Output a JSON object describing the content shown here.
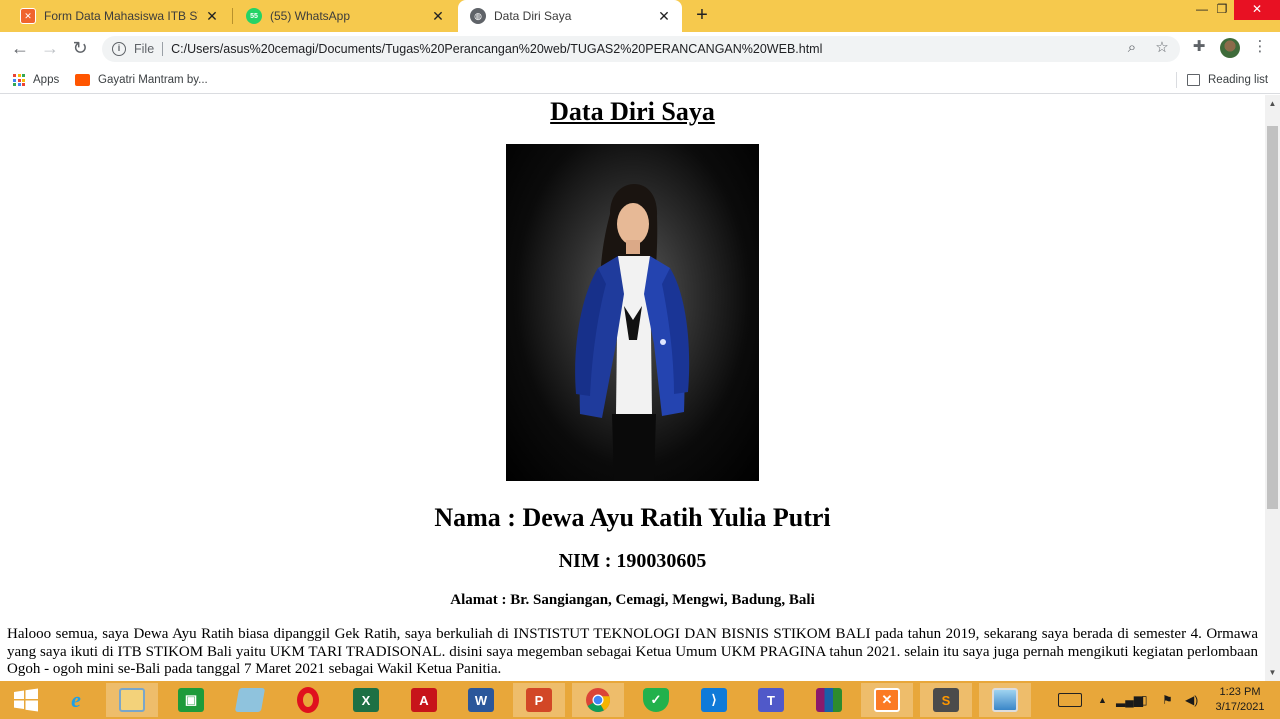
{
  "browser": {
    "tabs": [
      {
        "title": "Form Data Mahasiswa ITB STIKOM",
        "favicon": "xampp-icon",
        "active": false
      },
      {
        "title": "(55) WhatsApp",
        "favicon": "whatsapp-icon",
        "active": false
      },
      {
        "title": "Data Diri Saya",
        "favicon": "globe-icon",
        "active": true
      }
    ],
    "new_tab_glyph": "+",
    "url_scheme": "File",
    "url": "C:/Users/asus%20cemagi/Documents/Tugas%20Perancangan%20web/TUGAS2%20PERANCANGAN%20WEB.html",
    "bookmarks": [
      {
        "label": "Apps",
        "icon": "apps-grid-icon"
      },
      {
        "label": "Gayatri Mantram by...",
        "icon": "soundcloud-icon"
      }
    ],
    "reading_list_label": "Reading list",
    "accent_color": "#f6c94d"
  },
  "page": {
    "title": "Data Diri Saya",
    "nama": "Nama : Dewa Ayu Ratih Yulia Putri",
    "nim": "NIM : 190030605",
    "alamat": "Alamat : Br. Sangiangan, Cemagi, Mengwi, Badung, Bali",
    "paragraph": "Halooo semua, saya Dewa Ayu Ratih biasa dipanggil Gek Ratih, saya berkuliah di INSTISTUT TEKNOLOGI DAN BISNIS STIKOM BALI pada tahun 2019, sekarang saya berada di semester 4. Ormawa yang saya ikuti di ITB STIKOM Bali yaitu UKM TARI TRADISONAL. disini saya megemban sebagai Ketua Umum UKM PRAGINA tahun 2021. selain itu saya juga pernah mengikuti kegiatan perlombaan Ogoh - ogoh mini se-Bali pada tanggal 7 Maret 2021 sebagai Wakil Ketua Panitia."
  },
  "taskbar": {
    "apps": [
      "start-button",
      "internet-explorer",
      "file-explorer",
      "store",
      "notes",
      "opera",
      "excel",
      "acrobat",
      "word",
      "powerpoint",
      "chrome",
      "shield-vpn",
      "vscode",
      "teams",
      "winrar",
      "xampp",
      "sublime-text",
      "photos"
    ],
    "time": "1:23 PM",
    "date": "3/17/2021"
  }
}
